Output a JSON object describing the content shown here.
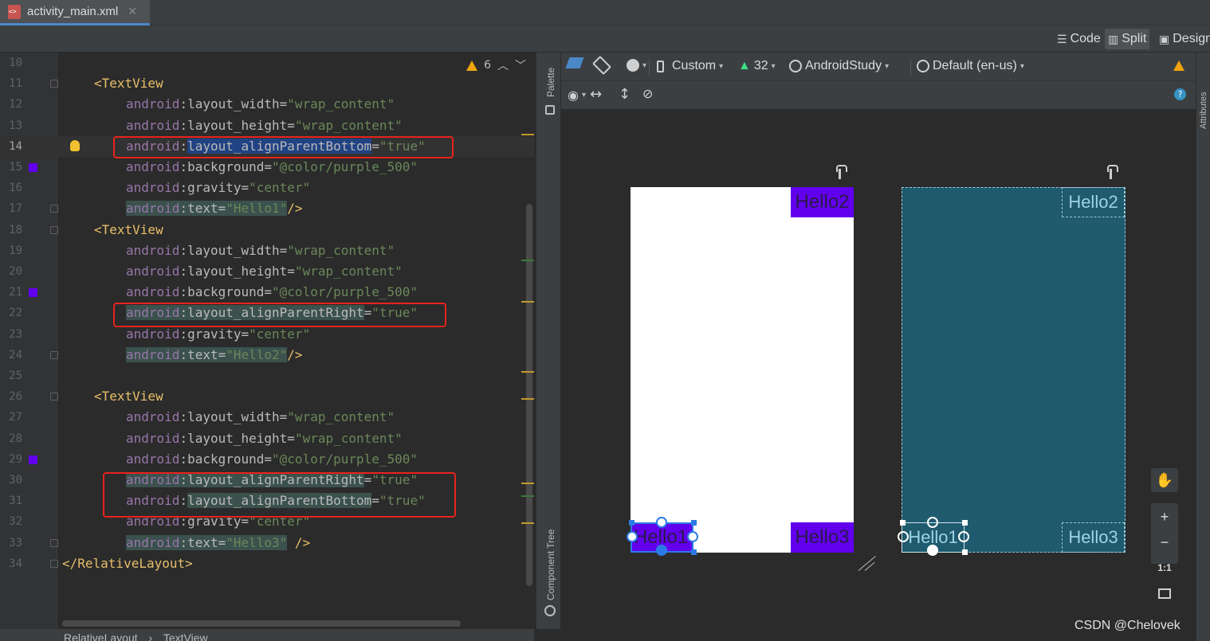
{
  "tab": {
    "file_name": "activity_main.xml",
    "close": "✕"
  },
  "modes": {
    "code": "Code",
    "split": "Split",
    "design": "Design"
  },
  "editor": {
    "warning_count": "6",
    "lines": [
      {
        "n": "10",
        "tokens": []
      },
      {
        "n": "11",
        "tokens": [
          [
            "tag",
            "<TextView"
          ]
        ],
        "indent": 1
      },
      {
        "n": "12",
        "tokens": [
          [
            "ns",
            "android"
          ],
          [
            "attr",
            ":layout_width="
          ],
          [
            "val",
            "\"wrap_content\""
          ]
        ],
        "indent": 2
      },
      {
        "n": "13",
        "tokens": [
          [
            "ns",
            "android"
          ],
          [
            "attr",
            ":layout_height="
          ],
          [
            "val",
            "\"wrap_content\""
          ]
        ],
        "indent": 2
      },
      {
        "n": "14",
        "tokens": [
          [
            "ns",
            "android"
          ],
          [
            "attr",
            ":"
          ],
          [
            "attr sel",
            "layout_alignParentBottom"
          ],
          [
            "attr",
            "="
          ],
          [
            "val",
            "\"true\""
          ]
        ],
        "indent": 2
      },
      {
        "n": "15",
        "tokens": [
          [
            "ns",
            "android"
          ],
          [
            "attr",
            ":background="
          ],
          [
            "val",
            "\"@color/purple_500\""
          ]
        ],
        "indent": 2
      },
      {
        "n": "16",
        "tokens": [
          [
            "ns",
            "android"
          ],
          [
            "attr",
            ":gravity="
          ],
          [
            "val",
            "\"center\""
          ]
        ],
        "indent": 2
      },
      {
        "n": "17",
        "tokens": [
          [
            "ns hl",
            "android"
          ],
          [
            "attr hl",
            ":text="
          ],
          [
            "val hl",
            "\"Hello1\""
          ],
          [
            "tag",
            "/>"
          ]
        ],
        "indent": 2
      },
      {
        "n": "18",
        "tokens": [
          [
            "tag",
            "<TextView"
          ]
        ],
        "indent": 1
      },
      {
        "n": "19",
        "tokens": [
          [
            "ns",
            "android"
          ],
          [
            "attr",
            ":layout_width="
          ],
          [
            "val",
            "\"wrap_content\""
          ]
        ],
        "indent": 2
      },
      {
        "n": "20",
        "tokens": [
          [
            "ns",
            "android"
          ],
          [
            "attr",
            ":layout_height="
          ],
          [
            "val",
            "\"wrap_content\""
          ]
        ],
        "indent": 2
      },
      {
        "n": "21",
        "tokens": [
          [
            "ns",
            "android"
          ],
          [
            "attr",
            ":background="
          ],
          [
            "val",
            "\"@color/purple_500\""
          ]
        ],
        "indent": 2
      },
      {
        "n": "22",
        "tokens": [
          [
            "ns hl",
            "android"
          ],
          [
            "attr hl",
            ":layout_alignParentRight"
          ],
          [
            "attr",
            "="
          ],
          [
            "val",
            "\"true\""
          ]
        ],
        "indent": 2
      },
      {
        "n": "23",
        "tokens": [
          [
            "ns",
            "android"
          ],
          [
            "attr",
            ":gravity="
          ],
          [
            "val",
            "\"center\""
          ]
        ],
        "indent": 2
      },
      {
        "n": "24",
        "tokens": [
          [
            "ns hl",
            "android"
          ],
          [
            "attr hl",
            ":text="
          ],
          [
            "val hl",
            "\"Hello2\""
          ],
          [
            "tag",
            "/>"
          ]
        ],
        "indent": 2
      },
      {
        "n": "25",
        "tokens": []
      },
      {
        "n": "26",
        "tokens": [
          [
            "tag",
            "<TextView"
          ]
        ],
        "indent": 1
      },
      {
        "n": "27",
        "tokens": [
          [
            "ns",
            "android"
          ],
          [
            "attr",
            ":layout_width="
          ],
          [
            "val",
            "\"wrap_content\""
          ]
        ],
        "indent": 2
      },
      {
        "n": "28",
        "tokens": [
          [
            "ns",
            "android"
          ],
          [
            "attr",
            ":layout_height="
          ],
          [
            "val",
            "\"wrap_content\""
          ]
        ],
        "indent": 2
      },
      {
        "n": "29",
        "tokens": [
          [
            "ns",
            "android"
          ],
          [
            "attr",
            ":background="
          ],
          [
            "val",
            "\"@color/purple_500\""
          ]
        ],
        "indent": 2
      },
      {
        "n": "30",
        "tokens": [
          [
            "ns hl",
            "android"
          ],
          [
            "attr hl",
            ":layout_alignParentRight"
          ],
          [
            "attr",
            "="
          ],
          [
            "val",
            "\"true\""
          ]
        ],
        "indent": 2
      },
      {
        "n": "31",
        "tokens": [
          [
            "ns",
            "android"
          ],
          [
            "attr",
            ":"
          ],
          [
            "attr hl",
            "layout_alignParentBottom"
          ],
          [
            "attr",
            "="
          ],
          [
            "val",
            "\"true\""
          ]
        ],
        "indent": 2
      },
      {
        "n": "32",
        "tokens": [
          [
            "ns",
            "android"
          ],
          [
            "attr",
            ":gravity="
          ],
          [
            "val",
            "\"center\""
          ]
        ],
        "indent": 2
      },
      {
        "n": "33",
        "tokens": [
          [
            "ns hl",
            "android"
          ],
          [
            "attr hl",
            ":text="
          ],
          [
            "val hl",
            "\"Hello3\""
          ],
          [
            "tag",
            " />"
          ]
        ],
        "indent": 2
      },
      {
        "n": "34",
        "tokens": [
          [
            "tag",
            "</RelativeLayout>"
          ]
        ],
        "indent": 0
      }
    ]
  },
  "breadcrumb": {
    "items": [
      "RelativeLayout",
      "TextView"
    ],
    "separator": "›"
  },
  "side_panels": {
    "palette": "Palette",
    "component_tree": "Component Tree",
    "attributes": "Attributes"
  },
  "design_toolbar": {
    "device": "Custom",
    "api_level": "32",
    "theme": "AndroidStudy",
    "locale": "Default (en-us)"
  },
  "preview": {
    "design_labels": [
      "Hello1",
      "Hello2",
      "Hello3"
    ],
    "blueprint_labels": [
      "Hello1",
      "Hello2",
      "Hello3"
    ]
  },
  "zoom": {
    "pan": "✋",
    "in": "+",
    "out": "−",
    "one_to_one": "1:1"
  },
  "watermark": "CSDN @Chelovek",
  "colors": {
    "purple_500": "#6200ee",
    "accent": "#4a88c7",
    "highlight_box": "#e8231c",
    "blueprint": "#1f5a6e"
  }
}
